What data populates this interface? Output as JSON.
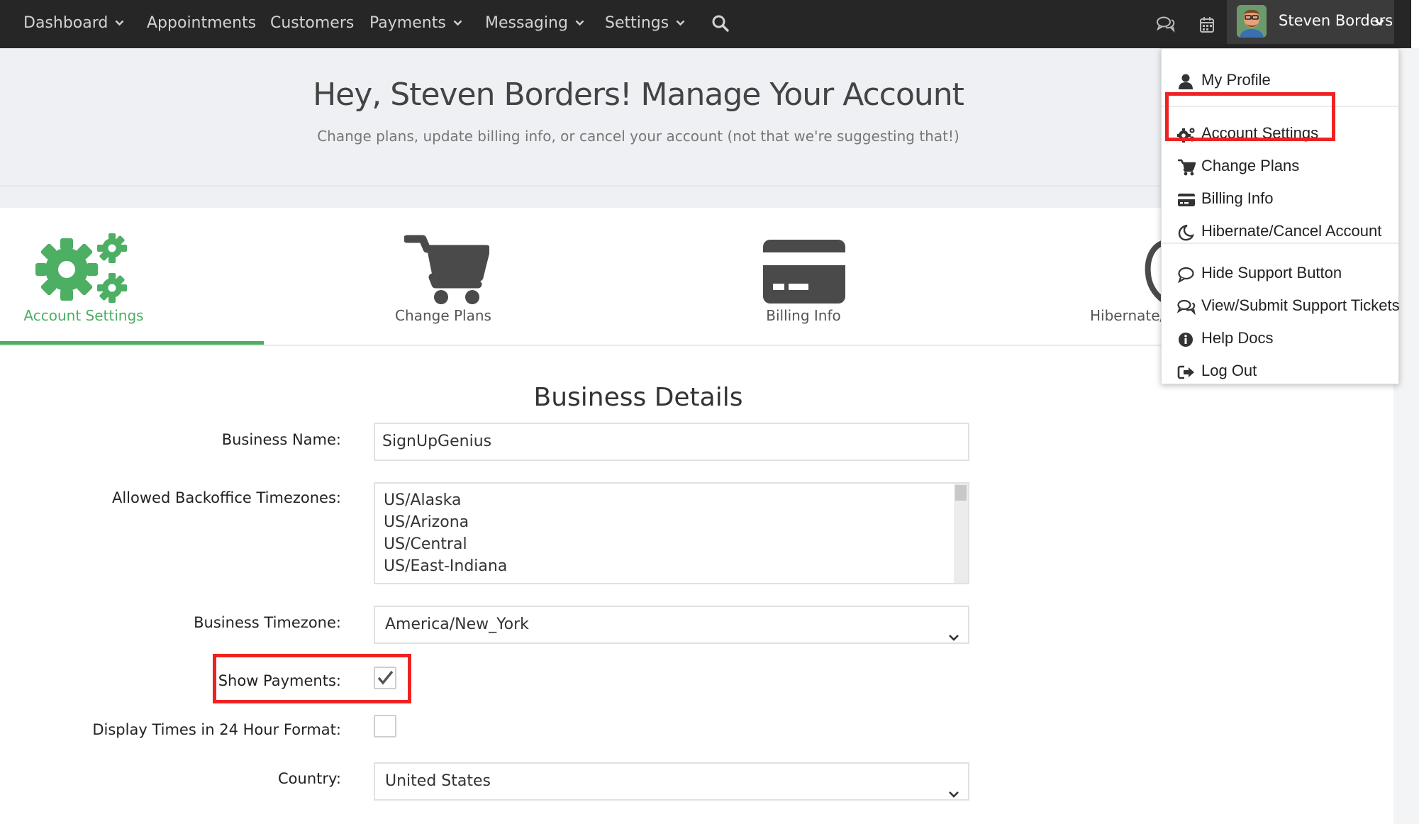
{
  "nav": {
    "items": [
      {
        "label": "Dashboard",
        "has_caret": true
      },
      {
        "label": "Appointments",
        "has_caret": false
      },
      {
        "label": "Customers",
        "has_caret": false
      },
      {
        "label": "Payments",
        "has_caret": true
      },
      {
        "label": "Messaging",
        "has_caret": true
      },
      {
        "label": "Settings",
        "has_caret": true
      }
    ],
    "search_icon": "search-icon",
    "chat_icon": "chat-icon",
    "calendar_icon": "calendar-icon",
    "user_name": "Steven Borders"
  },
  "hero": {
    "title": "Hey, Steven Borders! Manage Your Account",
    "subtitle": "Change plans, update billing info, or cancel your account (not that we're suggesting that!)"
  },
  "tabs": [
    {
      "label": "Account Settings",
      "icon": "gears-icon",
      "active": true
    },
    {
      "label": "Change Plans",
      "icon": "cart-icon",
      "active": false
    },
    {
      "label": "Billing Info",
      "icon": "credit-card-icon",
      "active": false
    },
    {
      "label": "Hibernate/",
      "icon": "moon-icon",
      "active": false
    }
  ],
  "form": {
    "title": "Business Details",
    "business_name_label": "Business Name:",
    "business_name_value": "SignUpGenius",
    "timezones_label": "Allowed Backoffice Timezones:",
    "timezones_options": [
      "US/Alaska",
      "US/Arizona",
      "US/Central",
      "US/East-Indiana"
    ],
    "business_timezone_label": "Business Timezone:",
    "business_timezone_value": "America/New_York",
    "show_payments_label": "Show Payments:",
    "show_payments_checked": true,
    "display_24h_label": "Display Times in 24 Hour Format:",
    "display_24h_checked": false,
    "country_label": "Country:",
    "country_value": "United States"
  },
  "dropdown": {
    "items": [
      {
        "label": "My Profile",
        "icon": "user-icon"
      },
      {
        "label": "Account Settings",
        "icon": "cogs-icon"
      },
      {
        "label": "Change Plans",
        "icon": "cart-icon"
      },
      {
        "label": "Billing Info",
        "icon": "credit-card-icon"
      },
      {
        "label": "Hibernate/Cancel Account",
        "icon": "moon-icon"
      },
      {
        "label": "Hide Support Button",
        "icon": "comment-icon"
      },
      {
        "label": "View/Submit Support Tickets",
        "icon": "comments-icon"
      },
      {
        "label": "Help Docs",
        "icon": "info-circle-icon"
      },
      {
        "label": "Log Out",
        "icon": "sign-out-icon"
      }
    ]
  },
  "colors": {
    "nav_bg": "#262626",
    "accent_green": "#4caf63",
    "highlight_red": "#ee2222",
    "icon_dark": "#4a4a4a"
  }
}
